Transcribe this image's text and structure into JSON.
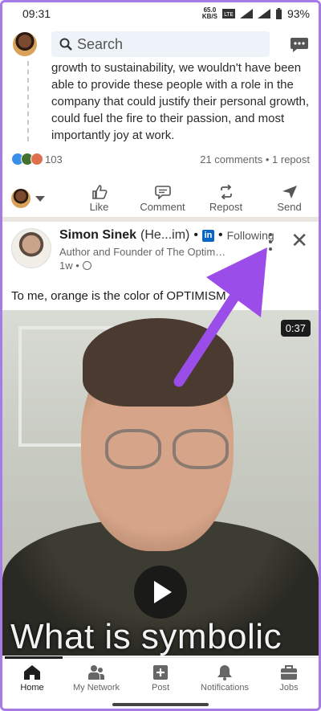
{
  "status_bar": {
    "time": "09:31",
    "data_speed_value": "65.0",
    "data_speed_unit": "KB/S",
    "battery": "93%"
  },
  "header": {
    "search_placeholder": "Search"
  },
  "previous_post": {
    "text": "growth to sustainability, we wouldn't have been able to provide these people with a role in the company that could justify their personal growth, could fuel the fire to their passion, and most importantly joy at work.",
    "reaction_count": "103",
    "comments_reposts": "21 comments • 1 repost"
  },
  "actions": {
    "like": "Like",
    "comment": "Comment",
    "repost": "Repost",
    "send": "Send"
  },
  "post": {
    "author_name": "Simon Sinek",
    "author_suffix": "(He...im)",
    "following": "Following",
    "headline": "Author and Founder of The Optimism ...",
    "time": "1w •",
    "caption": "To me, orange is the color of OPTIMISM."
  },
  "video": {
    "duration": "0:37",
    "subtitle": "What is symbolic"
  },
  "bottom_nav": {
    "items": [
      {
        "label": "Home",
        "icon": "home-icon"
      },
      {
        "label": "My Network",
        "icon": "network-icon"
      },
      {
        "label": "Post",
        "icon": "post-icon"
      },
      {
        "label": "Notifications",
        "icon": "bell-icon"
      },
      {
        "label": "Jobs",
        "icon": "briefcase-icon"
      }
    ]
  },
  "colors": {
    "annotation_arrow": "#9b4dea",
    "linkedin_blue": "#0a66c2"
  }
}
